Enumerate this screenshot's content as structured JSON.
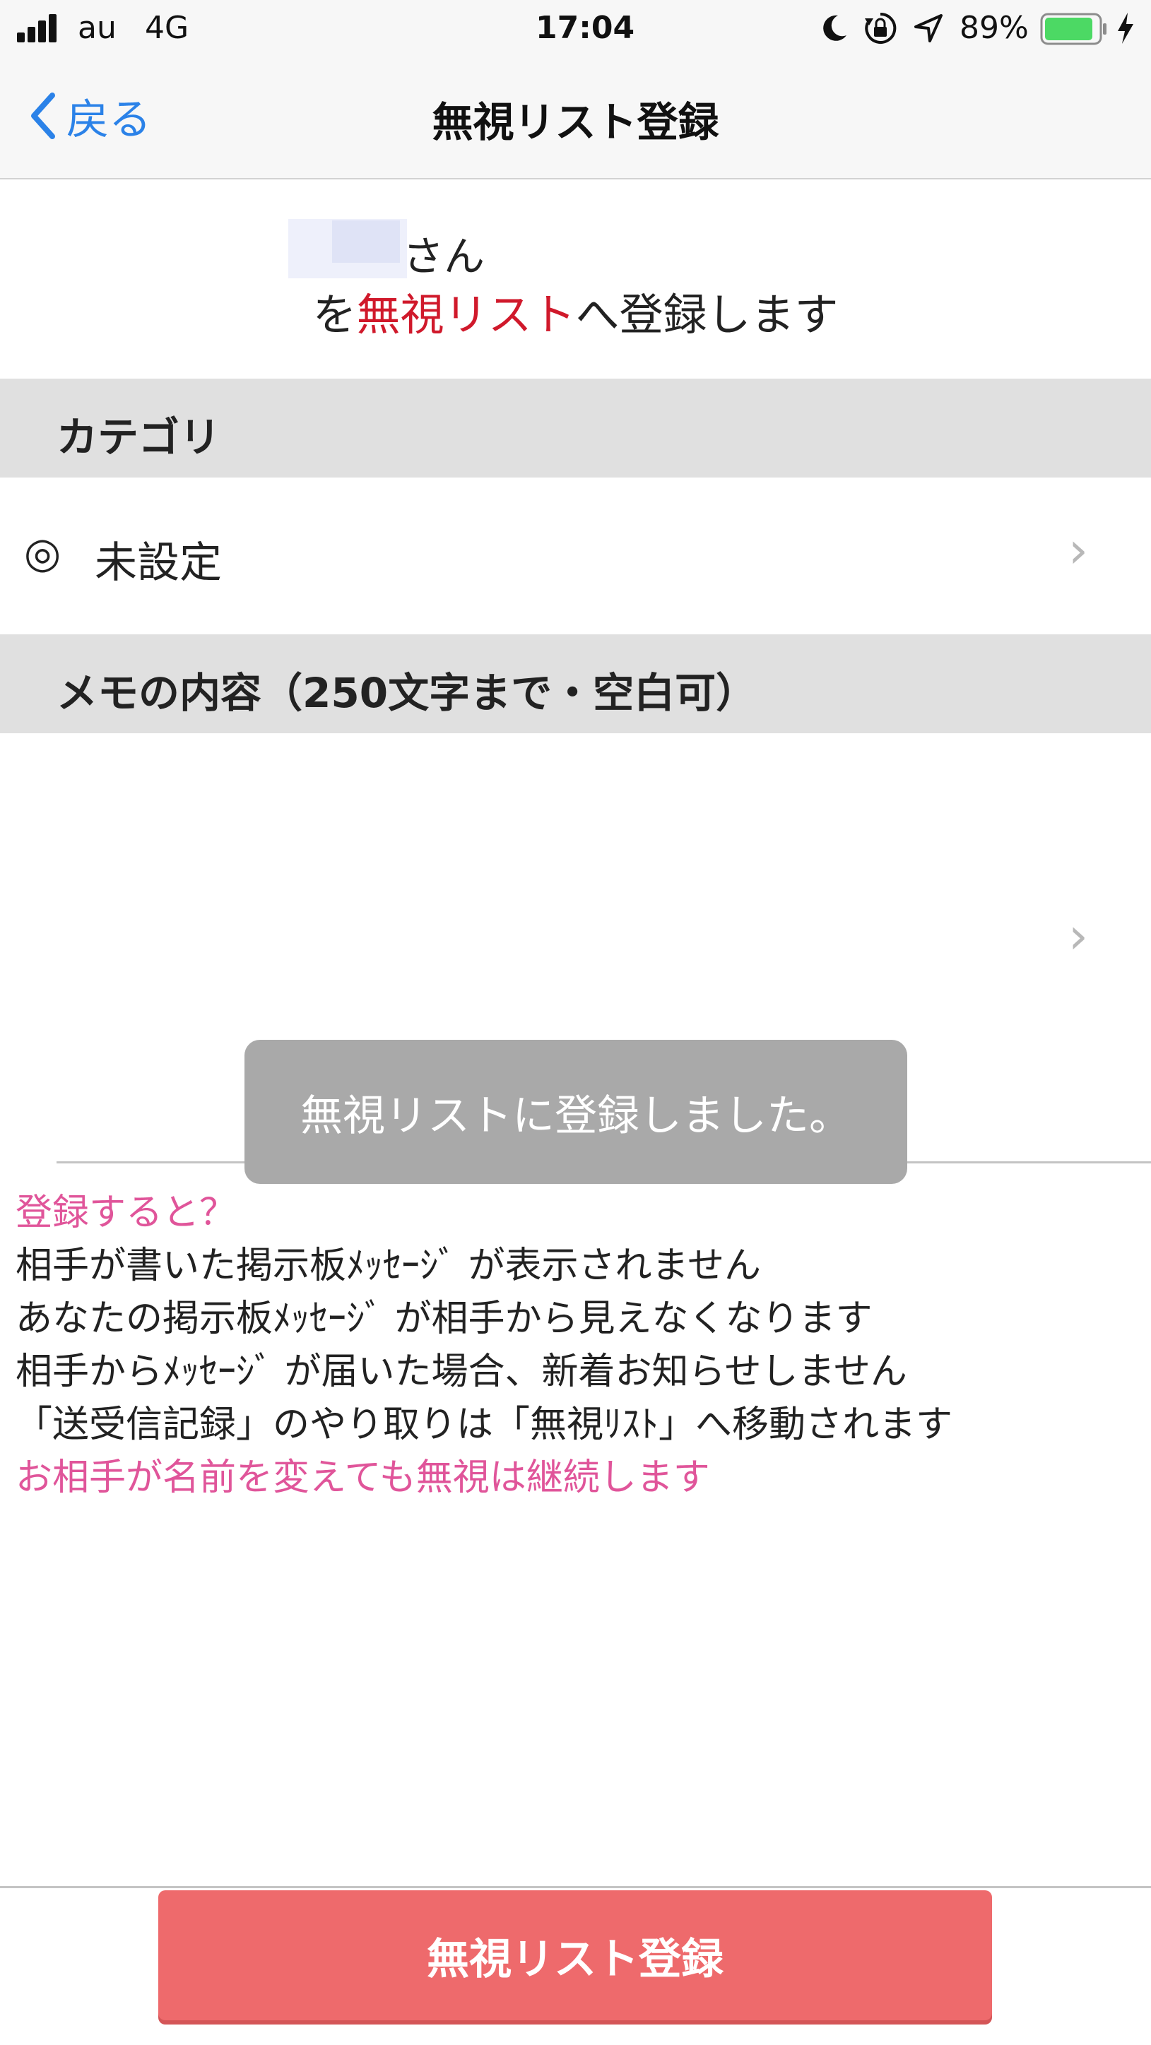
{
  "status_bar": {
    "carrier": "au",
    "network": "4G",
    "time": "17:04",
    "battery": "89%",
    "icons": [
      "signal-bars-icon",
      "moon-icon",
      "rotation-lock-icon",
      "location-arrow-icon",
      "battery-icon",
      "charging-bolt-icon"
    ]
  },
  "nav": {
    "back_label": "戻る",
    "title": "無視リスト登録"
  },
  "user": {
    "suffix": "さん",
    "line_prefix": "を",
    "line_highlight": "無視リスト",
    "line_suffix": "へ登録します"
  },
  "category": {
    "header": "カテゴリ",
    "icon": "◎",
    "value": "未設定"
  },
  "memo": {
    "header": "メモの内容（250文字まで・空白可）"
  },
  "toast": {
    "message": "無視リストに登録しました。"
  },
  "explanation": {
    "heading": "登録すると？",
    "lines": [
      "相手が書いた掲示板ﾒｯｾｰｼﾞ が表示されません",
      "あなたの掲示板ﾒｯｾｰｼﾞ が相手から見えなくなります",
      "相手からﾒｯｾｰｼﾞ が届いた場合、新着お知らせしません",
      "「送受信記録」のやり取りは「無視ﾘｽﾄ」へ移動されます"
    ],
    "note": "お相手が名前を変えても無視は継続します"
  },
  "submit": {
    "label": "無視リスト登録"
  },
  "colors": {
    "link_blue": "#2b82e8",
    "highlight_red": "#d0192b",
    "pink": "#e0559a",
    "button_red": "#ee6a6c",
    "battery_green": "#4cd964"
  }
}
